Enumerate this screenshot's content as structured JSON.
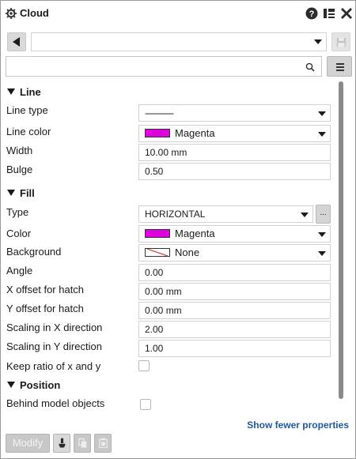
{
  "window": {
    "title": "Cloud",
    "icons": [
      "gear-icon",
      "help-icon",
      "layout-icon",
      "close-icon"
    ]
  },
  "toolbar": {
    "preset_value": "",
    "search_placeholder": ""
  },
  "sections": {
    "line": {
      "title": "Line"
    },
    "fill": {
      "title": "Fill"
    },
    "position": {
      "title": "Position"
    }
  },
  "properties": {
    "line_type": {
      "label": "Line type",
      "value": "------------"
    },
    "line_color": {
      "label": "Line color",
      "value": "Magenta",
      "color": "#e000e0"
    },
    "width": {
      "label": "Width",
      "value": "10.00 mm"
    },
    "bulge": {
      "label": "Bulge",
      "value": "0.50"
    },
    "fill_type": {
      "label": "Type",
      "value": "HORIZONTAL",
      "more_label": "..."
    },
    "fill_color": {
      "label": "Color",
      "value": "Magenta",
      "color": "#e000e0"
    },
    "background": {
      "label": "Background",
      "value": "None"
    },
    "angle": {
      "label": "Angle",
      "value": "0.00"
    },
    "x_offset": {
      "label": "X offset for hatch",
      "value": "0.00 mm"
    },
    "y_offset": {
      "label": "Y offset for hatch",
      "value": "0.00 mm"
    },
    "scale_x": {
      "label": "Scaling in X direction",
      "value": "2.00"
    },
    "scale_y": {
      "label": "Scaling in Y direction",
      "value": "1.00"
    },
    "keep_ratio": {
      "label": "Keep ratio of x and y",
      "checked": false
    },
    "behind_model": {
      "label": "Behind model objects",
      "checked": false
    }
  },
  "footer": {
    "show_fewer": "Show fewer properties",
    "modify_label": "Modify"
  },
  "colors": {
    "accent_link": "#1e5aa0",
    "magenta": "#e000e0"
  }
}
